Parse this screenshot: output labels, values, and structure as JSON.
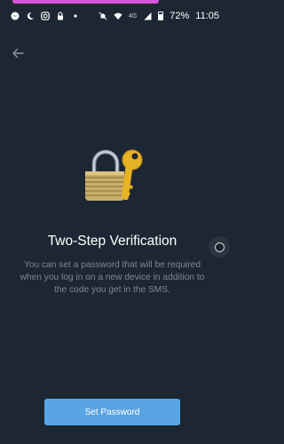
{
  "status_bar": {
    "battery": "72%",
    "time": "11:05",
    "network": "4G",
    "icons": [
      "messenger-icon",
      "moon-icon",
      "instagram-icon",
      "lock-icon",
      "dot-icon",
      "mute-icon",
      "wifi-icon",
      "signal-icon",
      "battery-icon"
    ]
  },
  "header": {
    "back_icon": "arrow-left-icon"
  },
  "illustration": {
    "icon": "lock-and-key-icon"
  },
  "content": {
    "title": "Two-Step Verification",
    "description": "You can set a password that will be required when you log in on a new device in addition to the code you get in the SMS."
  },
  "action": {
    "label": "Set Password"
  },
  "colors": {
    "background": "#1d2733",
    "accent": "#59a4e3",
    "muted_text": "#7c8792",
    "status_accent": "#d455d8"
  }
}
